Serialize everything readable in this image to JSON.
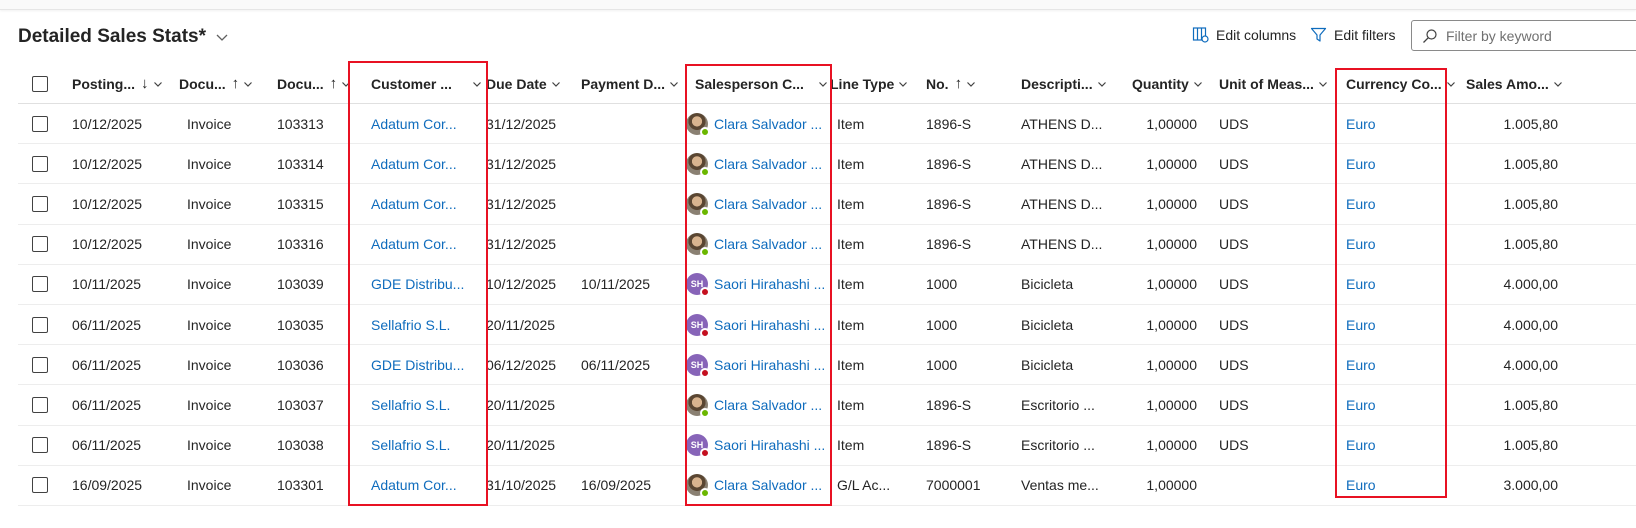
{
  "page": {
    "title": "Detailed Sales Stats*",
    "actions": {
      "edit_columns": "Edit columns",
      "edit_filters": "Edit filters"
    },
    "filter": {
      "placeholder": "Filter by keyword",
      "value": ""
    }
  },
  "columns": [
    {
      "label": "Posting...",
      "sort": "↓"
    },
    {
      "label": "Docu...",
      "sort": "↑"
    },
    {
      "label": "Docu...",
      "sort": "↑"
    },
    {
      "label": "Customer ...",
      "sort": ""
    },
    {
      "label": "Due Date",
      "sort": ""
    },
    {
      "label": "Payment D...",
      "sort": ""
    },
    {
      "label": "Salesperson C...",
      "sort": ""
    },
    {
      "label": "Line Type",
      "sort": ""
    },
    {
      "label": "No.",
      "sort": "↑"
    },
    {
      "label": "Descripti...",
      "sort": ""
    },
    {
      "label": "Quantity",
      "sort": ""
    },
    {
      "label": "Unit of Meas...",
      "sort": ""
    },
    {
      "label": "Currency Co...",
      "sort": ""
    },
    {
      "label": "Sales Amo...",
      "sort": ""
    }
  ],
  "rows": [
    {
      "posting_date": "10/12/2025",
      "doc_type": "Invoice",
      "doc_no": "103313",
      "customer": "Adatum Cor...",
      "due_date": "31/12/2025",
      "payment_date": "",
      "salesperson": "Clara Salvador ...",
      "avatar": "photo",
      "presence": "available",
      "initials": "",
      "line_type": "Item",
      "no": "1896-S",
      "description": "ATHENS D...",
      "quantity": "1,00000",
      "uom": "UDS",
      "currency": "Euro",
      "amount": "1.005,80"
    },
    {
      "posting_date": "10/12/2025",
      "doc_type": "Invoice",
      "doc_no": "103314",
      "customer": "Adatum Cor...",
      "due_date": "31/12/2025",
      "payment_date": "",
      "salesperson": "Clara Salvador ...",
      "avatar": "photo",
      "presence": "available",
      "initials": "",
      "line_type": "Item",
      "no": "1896-S",
      "description": "ATHENS D...",
      "quantity": "1,00000",
      "uom": "UDS",
      "currency": "Euro",
      "amount": "1.005,80"
    },
    {
      "posting_date": "10/12/2025",
      "doc_type": "Invoice",
      "doc_no": "103315",
      "customer": "Adatum Cor...",
      "due_date": "31/12/2025",
      "payment_date": "",
      "salesperson": "Clara Salvador ...",
      "avatar": "photo",
      "presence": "available",
      "initials": "",
      "line_type": "Item",
      "no": "1896-S",
      "description": "ATHENS D...",
      "quantity": "1,00000",
      "uom": "UDS",
      "currency": "Euro",
      "amount": "1.005,80"
    },
    {
      "posting_date": "10/12/2025",
      "doc_type": "Invoice",
      "doc_no": "103316",
      "customer": "Adatum Cor...",
      "due_date": "31/12/2025",
      "payment_date": "",
      "salesperson": "Clara Salvador ...",
      "avatar": "photo",
      "presence": "available",
      "initials": "",
      "line_type": "Item",
      "no": "1896-S",
      "description": "ATHENS D...",
      "quantity": "1,00000",
      "uom": "UDS",
      "currency": "Euro",
      "amount": "1.005,80"
    },
    {
      "posting_date": "10/11/2025",
      "doc_type": "Invoice",
      "doc_no": "103039",
      "customer": "GDE Distribu...",
      "due_date": "10/12/2025",
      "payment_date": "10/11/2025",
      "salesperson": "Saori Hirahashi ...",
      "avatar": "initials",
      "presence": "busy",
      "initials": "SH",
      "line_type": "Item",
      "no": "1000",
      "description": "Bicicleta",
      "quantity": "1,00000",
      "uom": "UDS",
      "currency": "Euro",
      "amount": "4.000,00"
    },
    {
      "posting_date": "06/11/2025",
      "doc_type": "Invoice",
      "doc_no": "103035",
      "customer": "Sellafrio S.L.",
      "due_date": "20/11/2025",
      "payment_date": "",
      "salesperson": "Saori Hirahashi ...",
      "avatar": "initials",
      "presence": "busy",
      "initials": "SH",
      "line_type": "Item",
      "no": "1000",
      "description": "Bicicleta",
      "quantity": "1,00000",
      "uom": "UDS",
      "currency": "Euro",
      "amount": "4.000,00"
    },
    {
      "posting_date": "06/11/2025",
      "doc_type": "Invoice",
      "doc_no": "103036",
      "customer": "GDE Distribu...",
      "due_date": "06/12/2025",
      "payment_date": "06/11/2025",
      "salesperson": "Saori Hirahashi ...",
      "avatar": "initials",
      "presence": "busy",
      "initials": "SH",
      "line_type": "Item",
      "no": "1000",
      "description": "Bicicleta",
      "quantity": "1,00000",
      "uom": "UDS",
      "currency": "Euro",
      "amount": "4.000,00"
    },
    {
      "posting_date": "06/11/2025",
      "doc_type": "Invoice",
      "doc_no": "103037",
      "customer": "Sellafrio S.L.",
      "due_date": "20/11/2025",
      "payment_date": "",
      "salesperson": "Clara Salvador ...",
      "avatar": "photo",
      "presence": "available",
      "initials": "",
      "line_type": "Item",
      "no": "1896-S",
      "description": "Escritorio ...",
      "quantity": "1,00000",
      "uom": "UDS",
      "currency": "Euro",
      "amount": "1.005,80"
    },
    {
      "posting_date": "06/11/2025",
      "doc_type": "Invoice",
      "doc_no": "103038",
      "customer": "Sellafrio S.L.",
      "due_date": "20/11/2025",
      "payment_date": "",
      "salesperson": "Saori Hirahashi ...",
      "avatar": "initials",
      "presence": "busy",
      "initials": "SH",
      "line_type": "Item",
      "no": "1896-S",
      "description": "Escritorio ...",
      "quantity": "1,00000",
      "uom": "UDS",
      "currency": "Euro",
      "amount": "1.005,80"
    },
    {
      "posting_date": "16/09/2025",
      "doc_type": "Invoice",
      "doc_no": "103301",
      "customer": "Adatum Cor...",
      "due_date": "31/10/2025",
      "payment_date": "16/09/2025",
      "salesperson": "Clara Salvador ...",
      "avatar": "photo",
      "presence": "available",
      "initials": "",
      "line_type": "G/L Ac...",
      "no": "7000001",
      "description": "Ventas me...",
      "quantity": "1,00000",
      "uom": "",
      "currency": "Euro",
      "amount": "3.000,00"
    }
  ],
  "colors": {
    "link": "#0f6cbd",
    "highlight": "#e81123",
    "available": "#6bb700",
    "busy": "#c50f1f",
    "avatar_initials_bg": "#8764b8"
  }
}
